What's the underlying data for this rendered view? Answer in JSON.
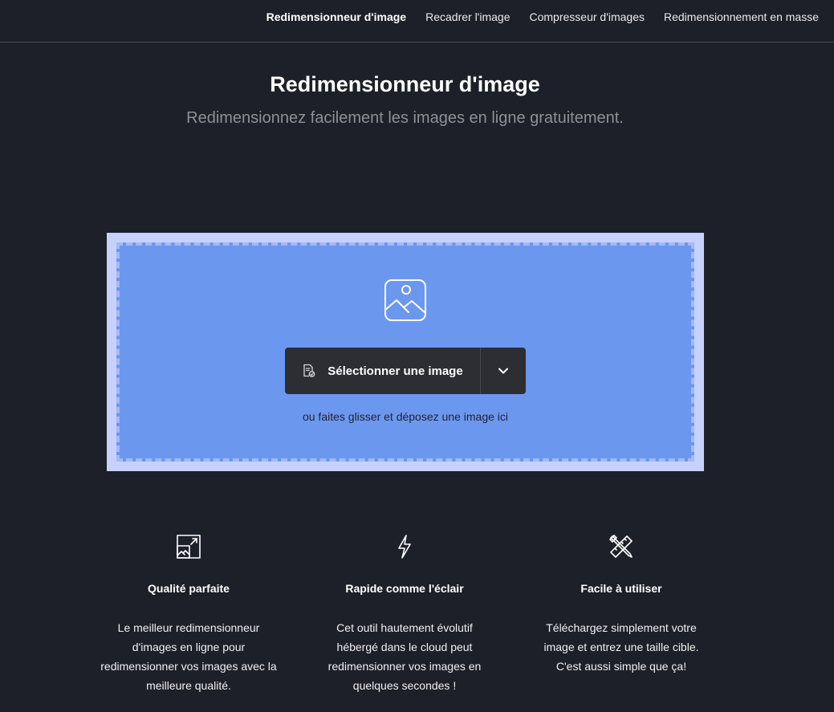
{
  "nav": {
    "items": [
      {
        "label": "Redimensionneur d'image",
        "active": true
      },
      {
        "label": "Recadrer l'image",
        "active": false
      },
      {
        "label": "Compresseur d'images",
        "active": false
      },
      {
        "label": "Redimensionnement en masse",
        "active": false
      }
    ]
  },
  "hero": {
    "title": "Redimensionneur d'image",
    "subtitle": "Redimensionnez facilement les images en ligne gratuitement."
  },
  "upload": {
    "icon": "image-icon",
    "button_icon": "file-image-icon",
    "button_label": "Sélectionner une image",
    "dropdown_icon": "chevron-down-icon",
    "drop_hint": "ou faites glisser et déposez une image ici"
  },
  "features": [
    {
      "icon": "resize-image-icon",
      "title": "Qualité parfaite",
      "desc": "Le meilleur redimensionneur d'images en ligne pour redimensionner vos images avec la meilleure qualité."
    },
    {
      "icon": "lightning-icon",
      "title": "Rapide comme l'éclair",
      "desc": "Cet outil hautement évolutif hébergé dans le cloud peut redimensionner vos images en quelques secondes !"
    },
    {
      "icon": "pencil-ruler-icon",
      "title": "Facile à utiliser",
      "desc": "Téléchargez simplement votre image et entrez une taille cible. C'est aussi simple que ça!"
    }
  ],
  "colors": {
    "background": "#1e2029",
    "dropzone_outer": "#c6d2fc",
    "dropzone_inner": "#6c97ef",
    "button": "#2d2e33"
  }
}
